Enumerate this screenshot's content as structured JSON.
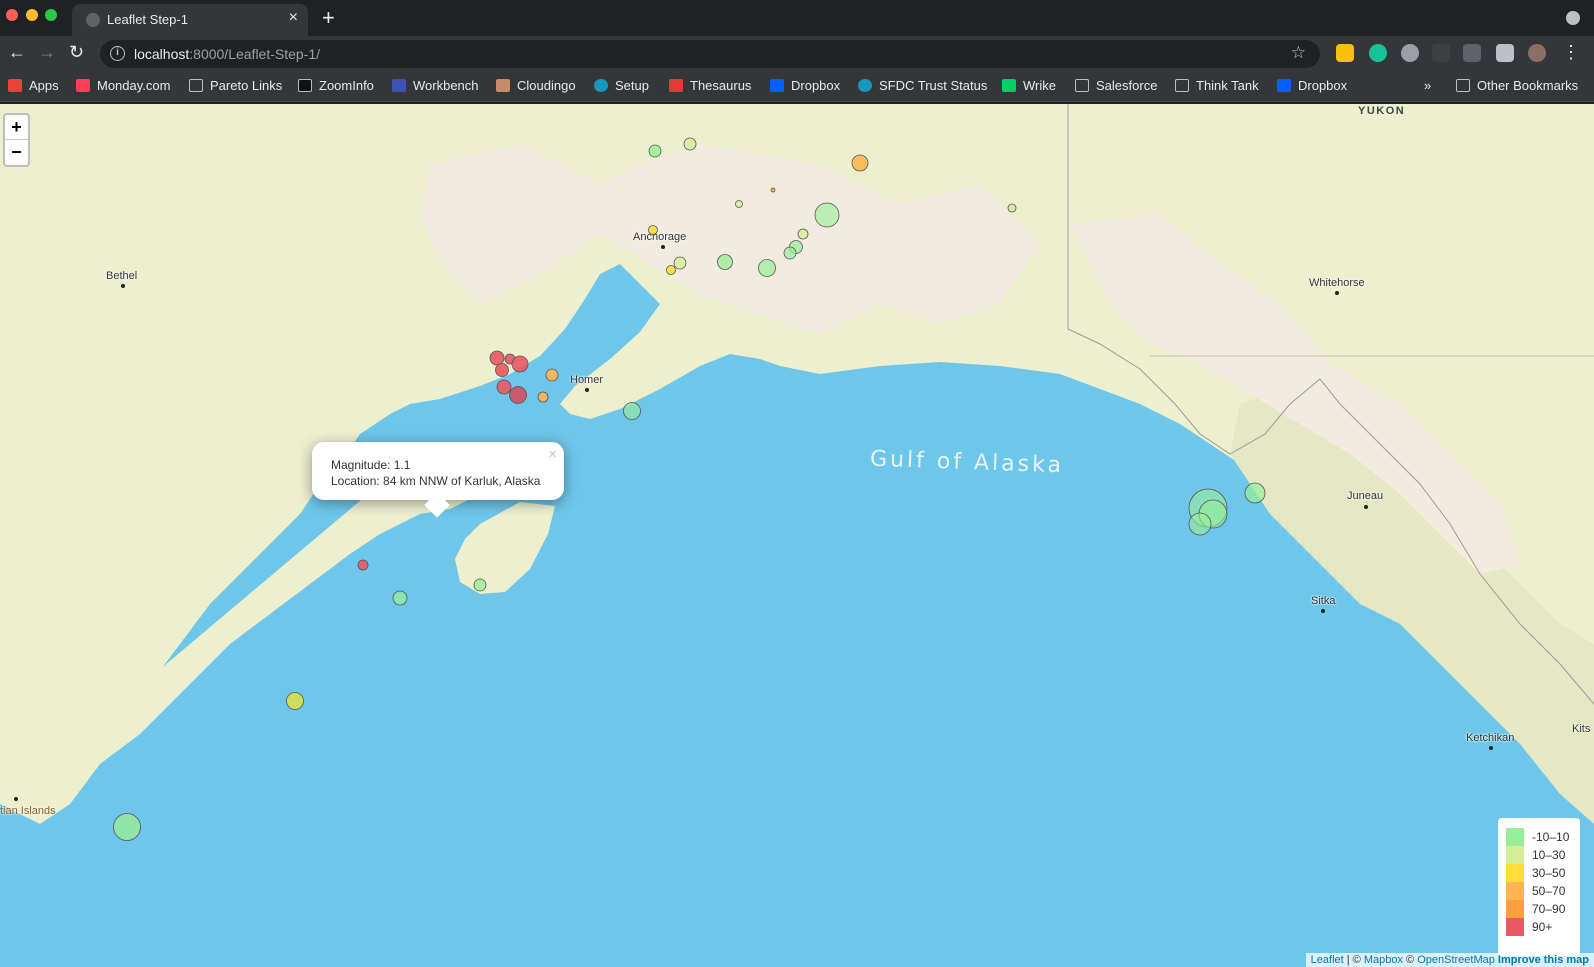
{
  "tab": {
    "title": "Leaflet Step-1",
    "close": "×",
    "new": "+"
  },
  "toolbar": {
    "url_host": "localhost",
    "url_path": ":8000/Leaflet-Step-1/",
    "info": "i",
    "star": "☆",
    "menu": "⋮"
  },
  "bookmarks": {
    "items": [
      "Apps",
      "Monday.com",
      "Pareto Links",
      "ZoomInfo",
      "Workbench",
      "Cloudingo",
      "Setup",
      "Thesaurus",
      "Dropbox",
      "SFDC Trust Status",
      "Wrike",
      "Salesforce",
      "Think Tank",
      "Dropbox"
    ],
    "overflow": "»",
    "other": "Other Bookmarks"
  },
  "map": {
    "zoom_in": "+",
    "zoom_out": "−",
    "places": [
      "YUKON",
      "Bethel",
      "Anchorage",
      "Homer",
      "Whitehorse",
      "Juneau",
      "Sitka",
      "Ketchikan",
      "Kits",
      "tian Islands"
    ],
    "sea_label": "Gulf of Alaska",
    "popup": {
      "line1": "Magnitude: 1.1",
      "line2": "Location: 84 km NNW of Karluk, Alaska",
      "close": "×"
    },
    "legend": {
      "labels": [
        "-10–10",
        "10–30",
        "30–50",
        "50–70",
        "70–90",
        "90+"
      ],
      "colors": [
        "#98ee98",
        "#d4ee98",
        "#fddd3b",
        "#fdb64f",
        "#fe9f3e",
        "#ea5863"
      ]
    },
    "attribution": {
      "leaflet": "Leaflet",
      "sep": " | © ",
      "mapbox": "Mapbox",
      "c2": " © ",
      "osm": "OpenStreetMap",
      "improve": "Improve this map"
    }
  }
}
